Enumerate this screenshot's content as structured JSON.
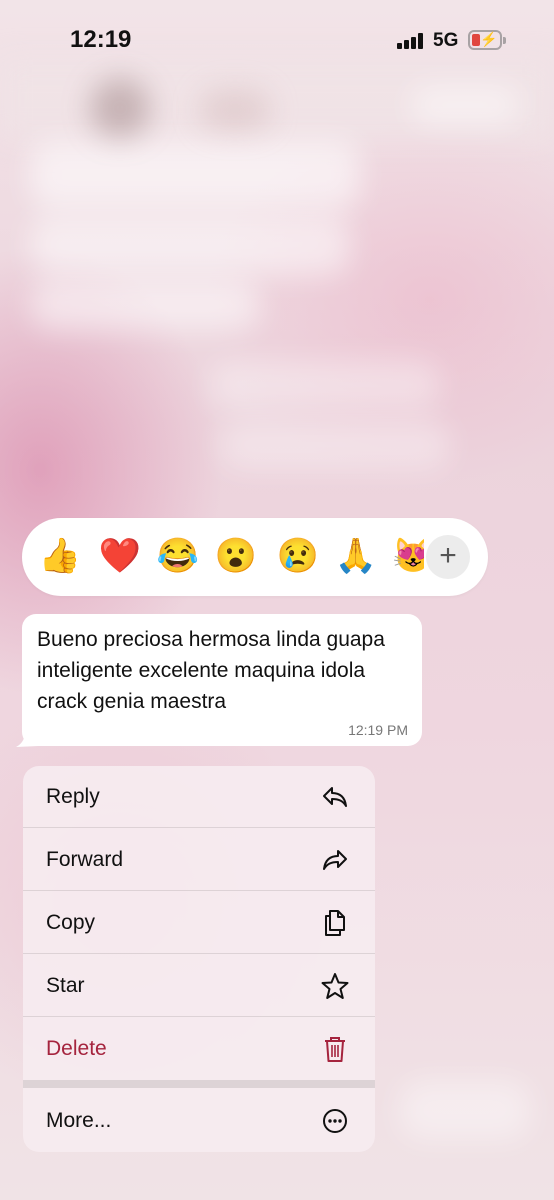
{
  "status_bar": {
    "time": "12:19",
    "network": "5G",
    "battery_level": 0.2,
    "battery_color": "#e0463f"
  },
  "reactions": {
    "emojis": [
      "👍",
      "❤️",
      "😂",
      "😮",
      "😢",
      "🙏",
      "😻"
    ],
    "more_icon": "plus-icon"
  },
  "message": {
    "text": "Bueno preciosa hermosa linda guapa inteligente excelente maquina idola crack genia maestra",
    "time": "12:19 PM"
  },
  "menu": {
    "items": [
      {
        "label": "Reply",
        "icon": "reply-icon"
      },
      {
        "label": "Forward",
        "icon": "forward-icon"
      },
      {
        "label": "Copy",
        "icon": "copy-icon"
      },
      {
        "label": "Star",
        "icon": "star-icon"
      },
      {
        "label": "Delete",
        "icon": "trash-icon",
        "color": "#a5243e"
      },
      {
        "label": "More...",
        "icon": "more-icon"
      }
    ]
  }
}
